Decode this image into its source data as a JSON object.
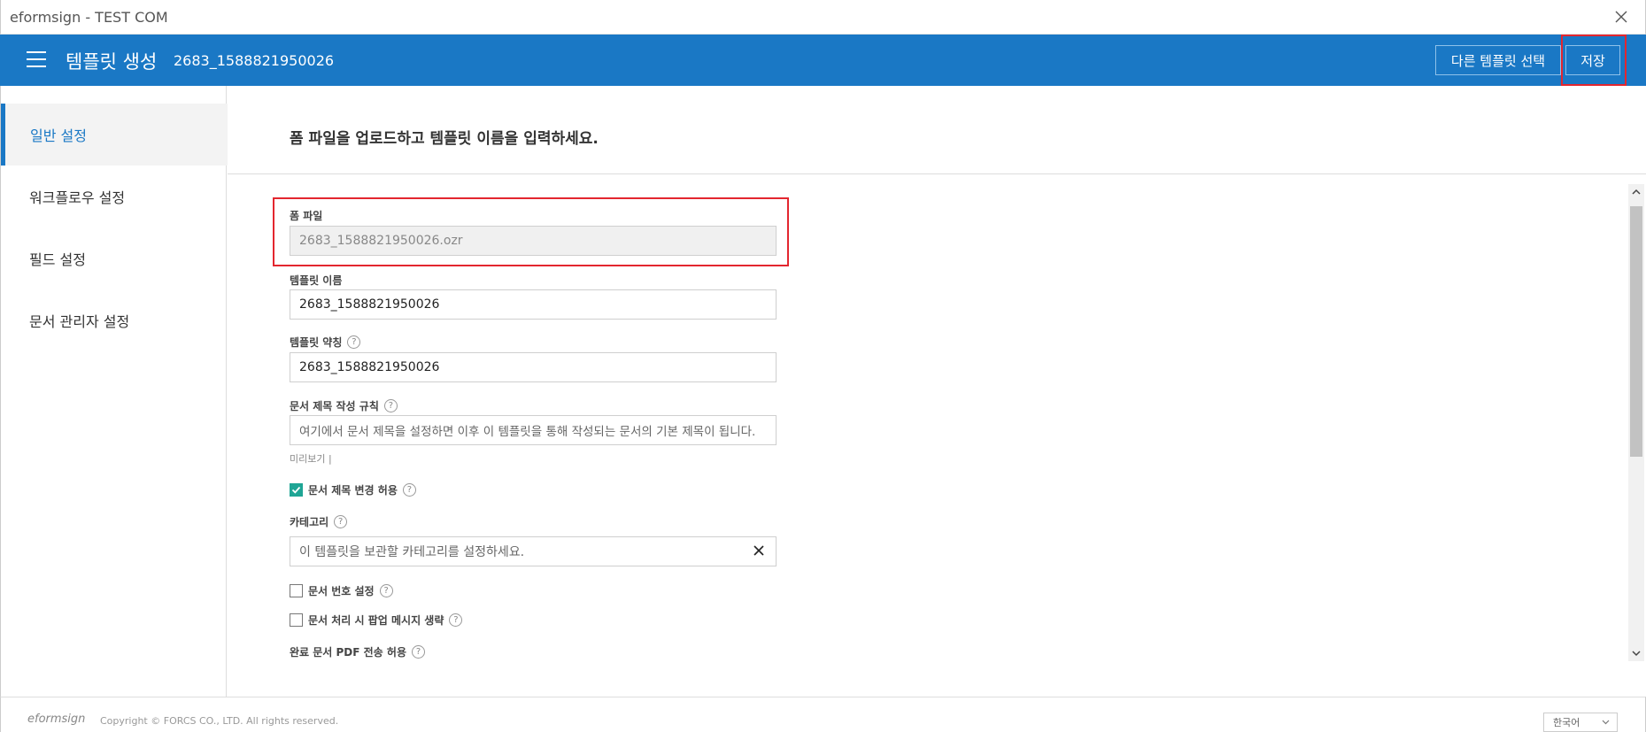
{
  "window": {
    "title": "eformsign - TEST COM"
  },
  "appbar": {
    "title": "템플릿 생성",
    "template_id": "2683_1588821950026",
    "other_template_button": "다른 템플릿 선택",
    "save_button": "저장"
  },
  "sidebar": {
    "items": [
      {
        "label": "일반 설정",
        "active": true
      },
      {
        "label": "워크플로우 설정",
        "active": false
      },
      {
        "label": "필드 설정",
        "active": false
      },
      {
        "label": "문서 관리자 설정",
        "active": false
      }
    ]
  },
  "main": {
    "header": "폼 파일을 업로드하고 템플릿 이름을 입력하세요.",
    "form_file": {
      "label": "폼 파일",
      "value": "2683_1588821950026.ozr"
    },
    "template_name": {
      "label": "템플릿 이름",
      "value": "2683_1588821950026"
    },
    "template_abbr": {
      "label": "템플릿 약칭",
      "value": "2683_1588821950026"
    },
    "doc_title_rule": {
      "label": "문서 제목 작성 규칙",
      "placeholder": "여기에서 문서 제목을 설정하면 이후 이 템플릿을 통해 작성되는 문서의 기본 제목이 됩니다."
    },
    "preview_label": "미리보기 |",
    "allow_title_change": {
      "label": "문서 제목 변경 허용",
      "checked": true
    },
    "category": {
      "label": "카테고리",
      "placeholder": "이 템플릿을 보관할 카테고리를 설정하세요."
    },
    "doc_number": {
      "label": "문서 번호 설정",
      "checked": false
    },
    "skip_popup": {
      "label": "문서 처리 시 팝업 메시지 생략",
      "checked": false
    },
    "pdf_send": {
      "label": "완료 문서 PDF 전송 허용"
    }
  },
  "footer": {
    "logo": "eformsign",
    "copyright": "Copyright © FORCS CO., LTD. All rights reserved.",
    "language": "한국어"
  },
  "colors": {
    "primary": "#1a78c5",
    "highlight": "#e3262f",
    "check": "#1fa595"
  },
  "icons": [
    "menu-icon",
    "close-icon",
    "help-icon",
    "clear-icon",
    "check-icon",
    "chevron-down-icon",
    "scroll-up-icon",
    "scroll-down-icon"
  ]
}
